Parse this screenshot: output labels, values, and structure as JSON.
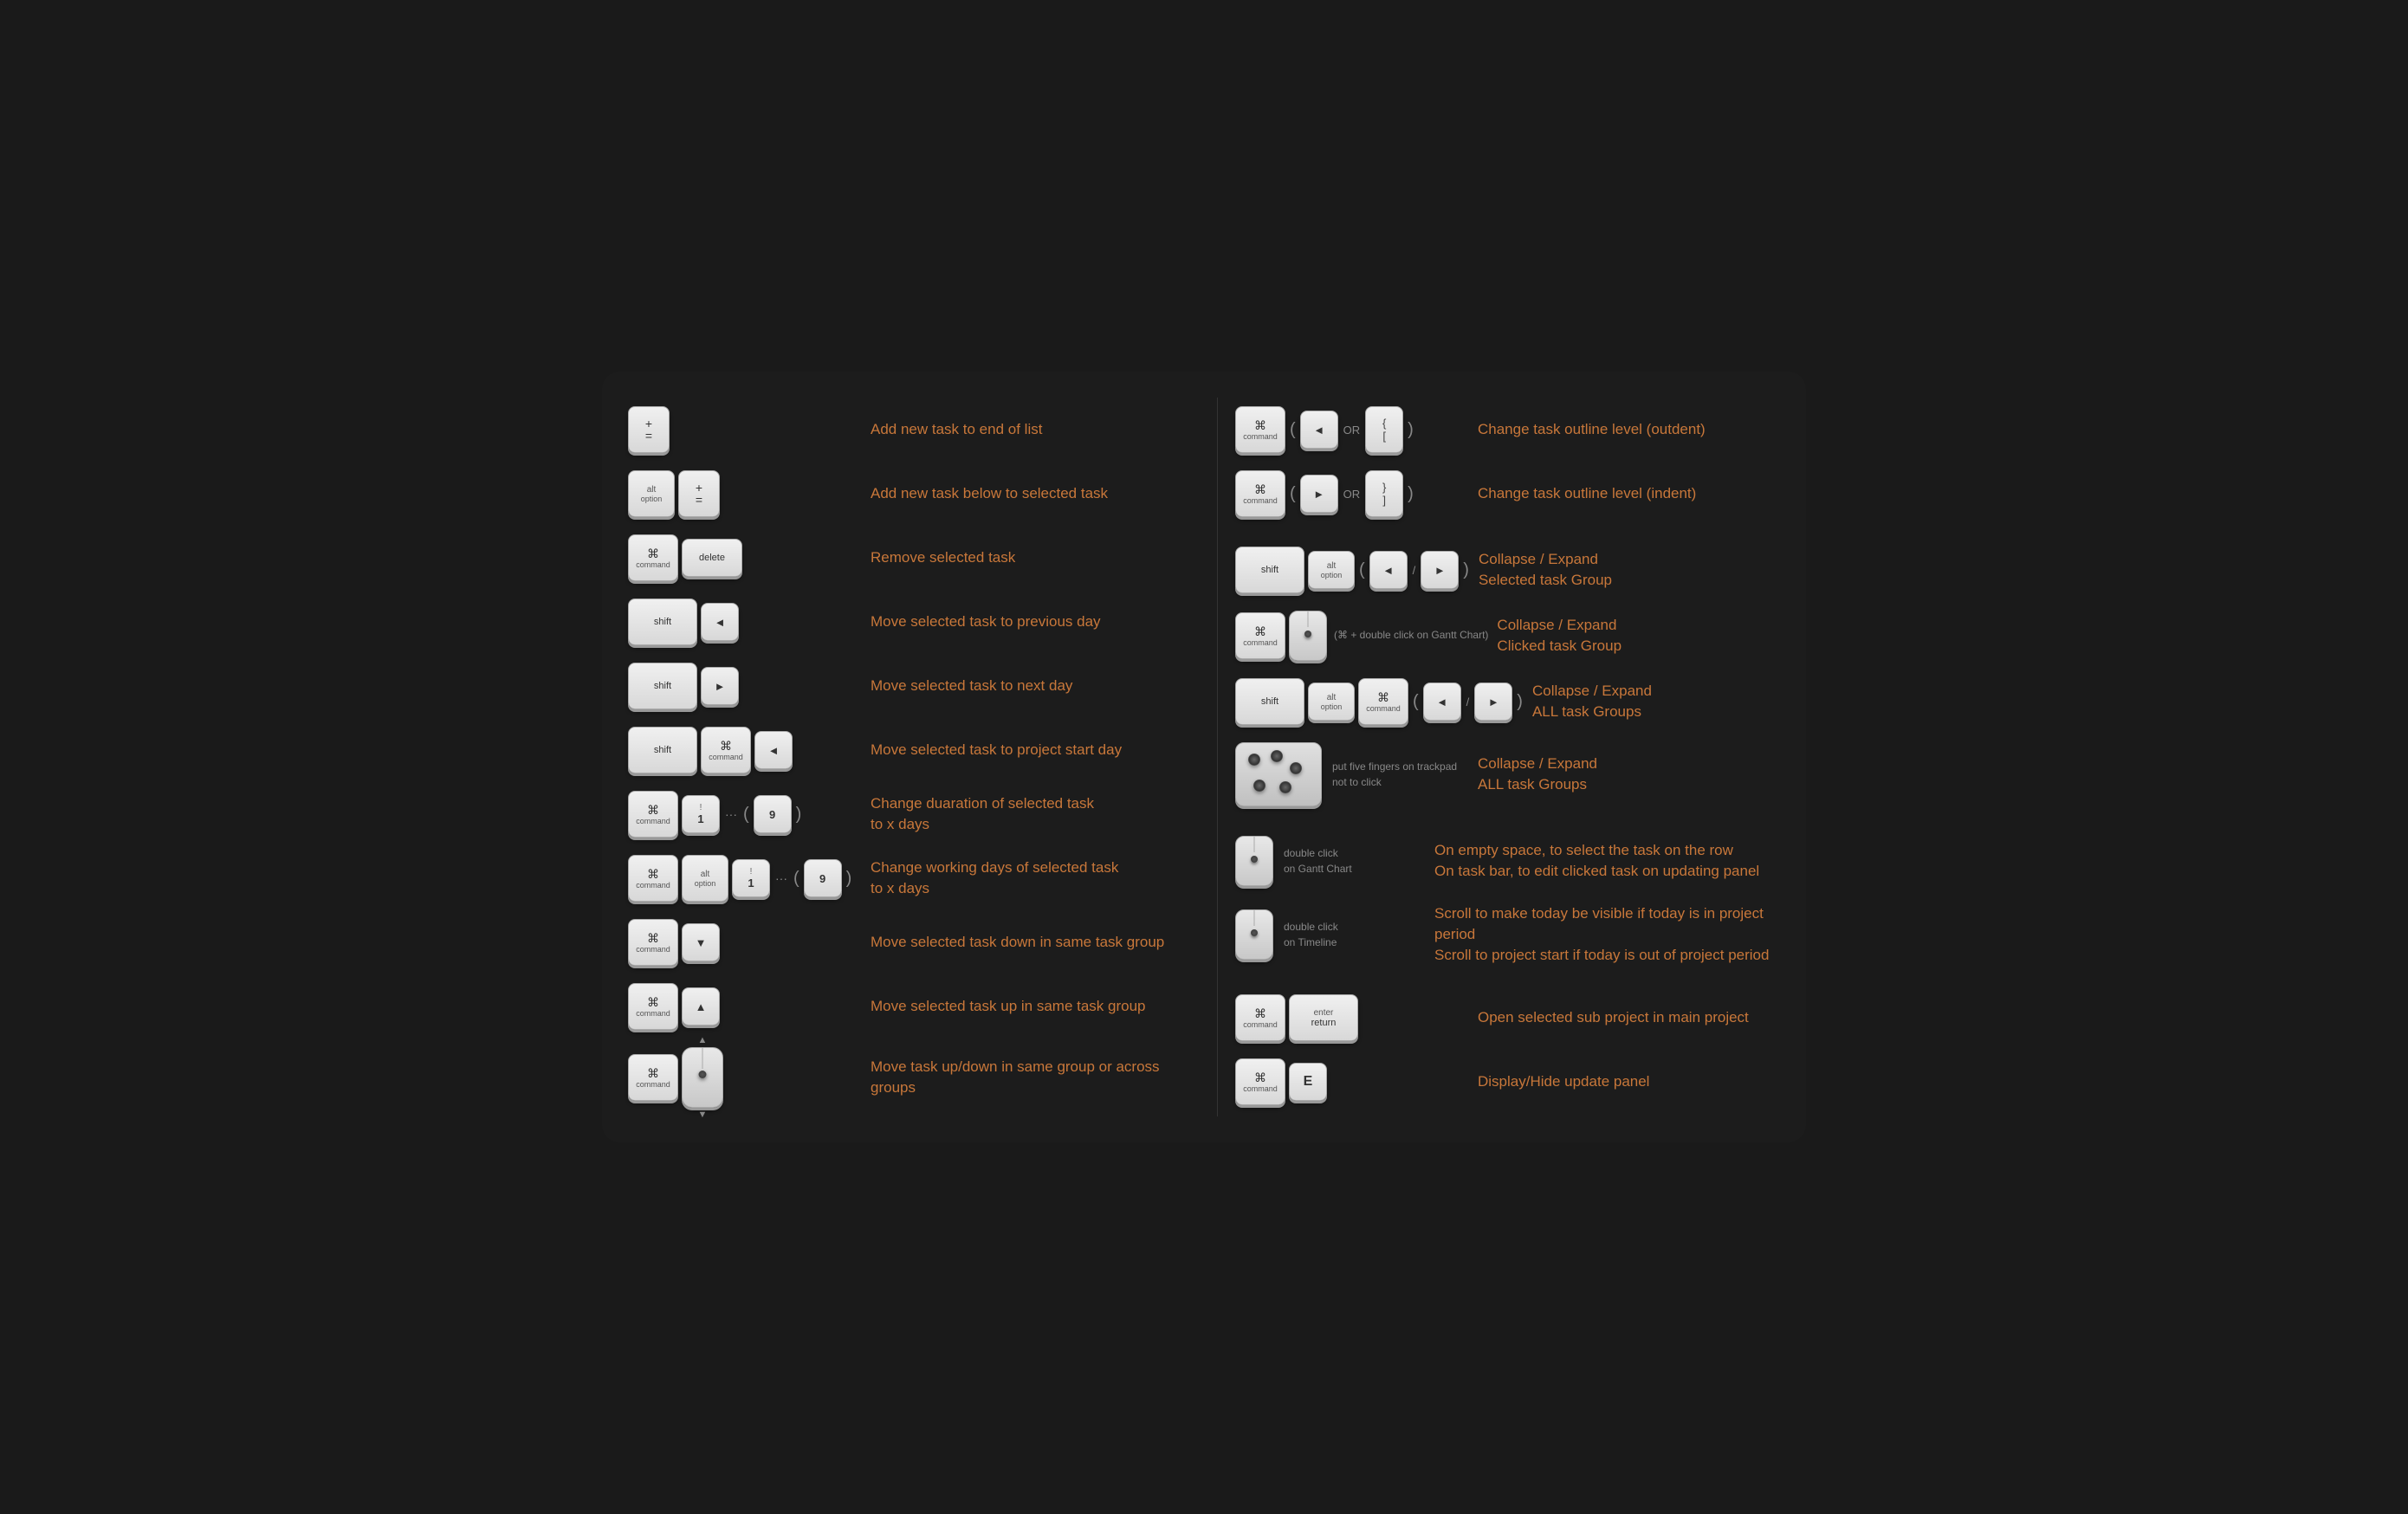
{
  "shortcuts": {
    "left": [
      {
        "id": "add-end",
        "keys": [
          "plus_eq"
        ],
        "description": "Add new task to end of list"
      },
      {
        "id": "add-below",
        "keys": [
          "alt",
          "plus_eq"
        ],
        "description": "Add new task below to selected task"
      },
      {
        "id": "remove",
        "keys": [
          "cmd",
          "delete"
        ],
        "description": "Remove selected task"
      },
      {
        "id": "prev-day",
        "keys": [
          "shift",
          "left"
        ],
        "description": "Move selected task to previous day"
      },
      {
        "id": "next-day",
        "keys": [
          "shift",
          "right"
        ],
        "description": "Move selected task to next day"
      },
      {
        "id": "project-start",
        "keys": [
          "shift",
          "cmd",
          "left"
        ],
        "description": "Move selected task to project start day"
      },
      {
        "id": "duration",
        "keys": [
          "cmd",
          "1to9"
        ],
        "description": "Change duaration of selected task\nto x days"
      },
      {
        "id": "working-days",
        "keys": [
          "cmd",
          "alt",
          "1to9"
        ],
        "description": "Change working days of selected task\nto x days"
      },
      {
        "id": "move-down",
        "keys": [
          "cmd",
          "down"
        ],
        "description": "Move selected task down in same task group"
      },
      {
        "id": "move-up",
        "keys": [
          "cmd",
          "up"
        ],
        "description": "Move selected task up in same task group"
      },
      {
        "id": "drag",
        "keys": [
          "cmd",
          "mouse"
        ],
        "description": "Move task up/down in same group or across groups"
      }
    ],
    "right": [
      {
        "id": "outdent",
        "keys": [
          "cmd",
          "left_or_brace_open"
        ],
        "description": "Change task outline level (outdent)"
      },
      {
        "id": "indent",
        "keys": [
          "cmd",
          "right_or_brace_close"
        ],
        "description": "Change task outline level (indent)"
      },
      {
        "id": "collapse-selected",
        "keys": [
          "shift",
          "alt",
          "left_slash_right"
        ],
        "description": "Collapse / Expand\nSelected task Group"
      },
      {
        "id": "collapse-clicked",
        "keys": [
          "cmd",
          "dblclick_gantt"
        ],
        "description": "Collapse / Expand\nClicked task Group"
      },
      {
        "id": "collapse-all",
        "keys": [
          "shift",
          "alt",
          "cmd",
          "left_slash_right"
        ],
        "description": "Collapse / Expand\nALL task Groups"
      },
      {
        "id": "five-fingers",
        "keys": [
          "trackpad"
        ],
        "description": "Collapse / Expand\nALL task Groups",
        "trackpad_label": "put five fingers on trackpad\nnot to click"
      },
      {
        "id": "dblclick-gantt",
        "keys": [
          "dblclick_gantt_mouse"
        ],
        "description": "On empty space, to select the task on the row\nOn task bar,  to edit clicked task on updating panel",
        "mouse_label": "double click\non Gantt Chart"
      },
      {
        "id": "dblclick-timeline",
        "keys": [
          "dblclick_timeline_mouse"
        ],
        "description": "Scroll to make today be visible if today is in project period\nScroll to project start if today is out of project period",
        "mouse_label": "double click\non Timeline"
      },
      {
        "id": "open-sub",
        "keys": [
          "cmd",
          "enter"
        ],
        "description": "Open selected sub project in main project"
      },
      {
        "id": "toggle-panel",
        "keys": [
          "cmd",
          "E"
        ],
        "description": "Display/Hide update panel"
      }
    ]
  },
  "colors": {
    "description": "#c8773a",
    "background": "#1c1c1c",
    "key_bg_top": "#f0f0f0",
    "key_bg_bottom": "#d8d8d8",
    "key_text": "#333333",
    "operator": "#888888"
  },
  "labels": {
    "cmd_symbol": "⌘",
    "cmd_text": "command",
    "alt_top": "alt",
    "alt_bottom": "option",
    "shift": "shift",
    "delete": "delete",
    "enter_top": "enter",
    "enter_bottom": "return",
    "arrow_left": "◄",
    "arrow_right": "►",
    "arrow_up": "▲",
    "arrow_down": "▼",
    "or_text": "OR",
    "slash": "/",
    "open_paren": "(",
    "close_paren": ")",
    "plus": "+",
    "eq": "=",
    "excl": "!",
    "num1": "1",
    "num9": "9",
    "dots": "···",
    "open_paren_key": "(",
    "close_paren_key": ")",
    "open_brace": "{",
    "close_brace": "}",
    "open_bracket": "[",
    "close_bracket": "]",
    "e_key": "E"
  }
}
